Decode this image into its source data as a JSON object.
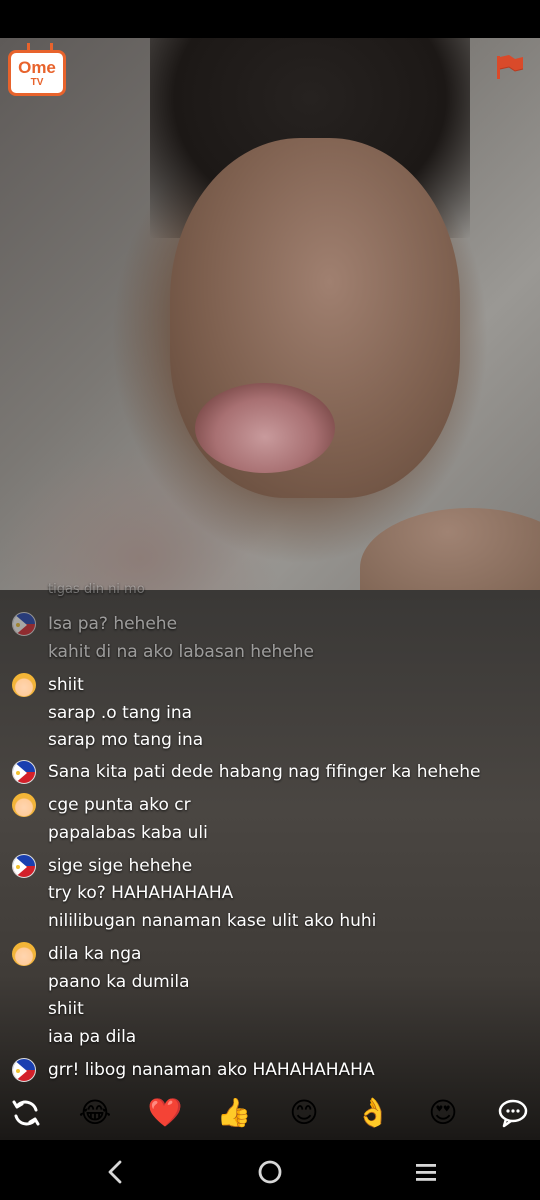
{
  "app": {
    "logo_top": "Ome",
    "logo_bottom": "TV"
  },
  "chat": {
    "messages": [
      {
        "avatar": "none",
        "text": "tigas din ni mo",
        "style": "cut"
      },
      {
        "avatar": "philippines-flag",
        "text": "Isa pa? hehehe",
        "style": "faded"
      },
      {
        "avatar": "none",
        "text": "kahit di na ako labasan hehehe",
        "style": "faded"
      },
      {
        "avatar": "girl-emoji",
        "text": "shiit",
        "style": "normal"
      },
      {
        "avatar": "none",
        "text": "sarap .o tang ina",
        "style": "normal"
      },
      {
        "avatar": "none",
        "text": "sarap mo tang ina",
        "style": "normal"
      },
      {
        "avatar": "philippines-flag",
        "text": "Sana kita pati dede habang nag fifinger ka hehehe",
        "style": "normal"
      },
      {
        "avatar": "girl-emoji",
        "text": "cge punta ako cr",
        "style": "normal"
      },
      {
        "avatar": "none",
        "text": "papalabas kaba uli",
        "style": "normal"
      },
      {
        "avatar": "philippines-flag",
        "text": "sige sige hehehe",
        "style": "normal"
      },
      {
        "avatar": "none",
        "text": "try ko? HAHAHAHAHA",
        "style": "normal"
      },
      {
        "avatar": "none",
        "text": "nililibugan nanaman kase ulit ako huhi",
        "style": "normal"
      },
      {
        "avatar": "girl-emoji",
        "text": "dila ka nga",
        "style": "normal"
      },
      {
        "avatar": "none",
        "text": "paano ka dumila",
        "style": "normal"
      },
      {
        "avatar": "none",
        "text": "shiit",
        "style": "normal"
      },
      {
        "avatar": "none",
        "text": "iaa pa dila",
        "style": "normal"
      },
      {
        "avatar": "philippines-flag",
        "text": "grr! libog nanaman ako HAHAHAHAHA",
        "style": "normal"
      }
    ]
  },
  "emoji_bar": {
    "items": [
      "refresh-icon",
      "😂",
      "❤️",
      "👍",
      "😊",
      "👌",
      "😍",
      "chat-bubble-icon"
    ],
    "laugh": "😂",
    "heart": "❤️",
    "thumbs": "👍",
    "smile": "😊",
    "ok": "👌",
    "heart_eyes": "😍"
  },
  "nav": {
    "items": [
      "back-icon",
      "home-icon",
      "recents-icon"
    ]
  },
  "colors": {
    "brand": "#e8632c",
    "chat_text": "#ffffff",
    "nav_bg": "#000000"
  }
}
